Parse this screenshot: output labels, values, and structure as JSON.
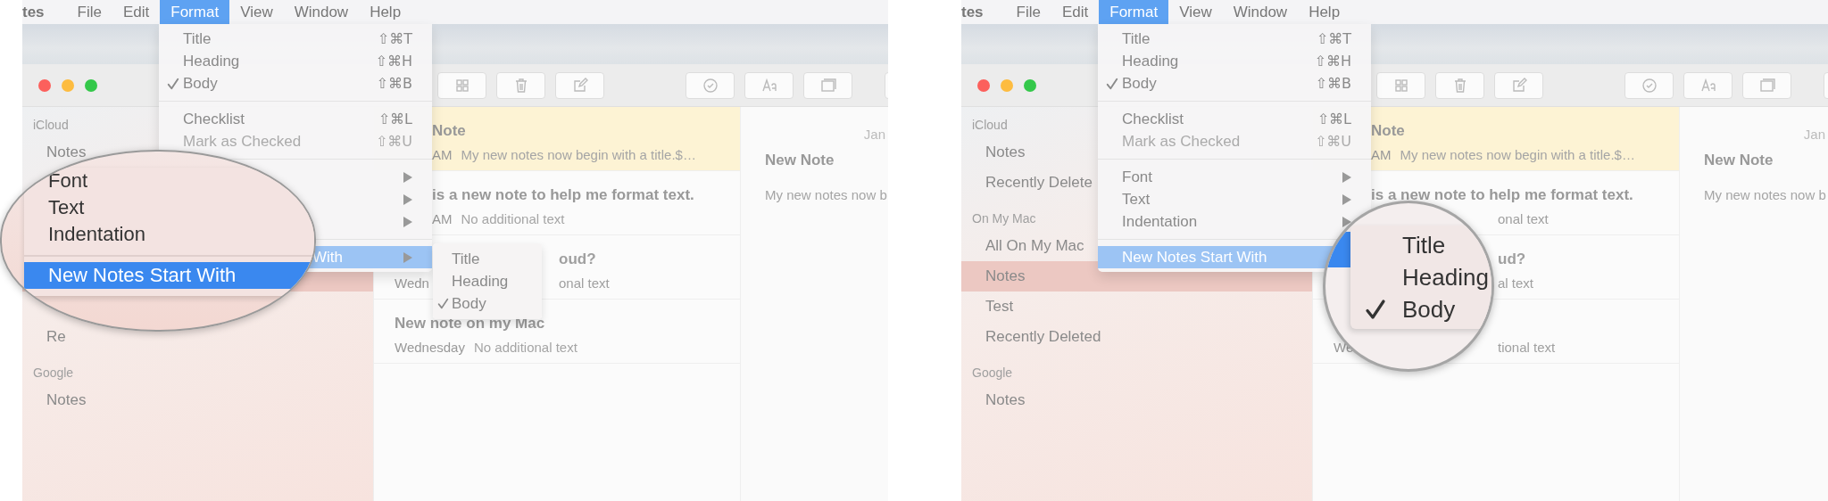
{
  "panels": [
    {
      "menubar": [
        {
          "label": "tes",
          "kind": "app",
          "selected": false
        },
        {
          "label": "File",
          "kind": "menu",
          "selected": false
        },
        {
          "label": "Edit",
          "kind": "menu",
          "selected": false
        },
        {
          "label": "Format",
          "kind": "menu",
          "selected": true
        },
        {
          "label": "View",
          "kind": "menu",
          "selected": false
        },
        {
          "label": "Window",
          "kind": "menu",
          "selected": false
        },
        {
          "label": "Help",
          "kind": "menu",
          "selected": false
        }
      ],
      "menu": [
        {
          "kind": "item",
          "label": "Title",
          "shortcut": "⇧⌘T",
          "checked": false,
          "disabled": false
        },
        {
          "kind": "item",
          "label": "Heading",
          "shortcut": "⇧⌘H",
          "checked": false,
          "disabled": false
        },
        {
          "kind": "item",
          "label": "Body",
          "shortcut": "⇧⌘B",
          "checked": true,
          "disabled": false
        },
        {
          "kind": "separator"
        },
        {
          "kind": "item",
          "label": "Checklist",
          "shortcut": "⇧⌘L",
          "checked": false,
          "disabled": false
        },
        {
          "kind": "item",
          "label": "Mark as Checked",
          "shortcut": "⇧⌘U",
          "checked": false,
          "disabled": true
        },
        {
          "kind": "separator"
        },
        {
          "kind": "submenu",
          "selected": false,
          "arrow": true
        },
        {
          "kind": "submenu",
          "selected": false,
          "arrow": true
        },
        {
          "kind": "submenu",
          "selected": false,
          "arrow": true
        },
        {
          "kind": "separator"
        },
        {
          "kind": "submenu",
          "label": "With",
          "selected": true,
          "cut": true,
          "arrow": true
        }
      ],
      "submenu": [
        {
          "label": "Title",
          "checked": false
        },
        {
          "label": "Heading",
          "checked": false
        },
        {
          "label": "Body",
          "checked": true
        }
      ],
      "sidebar": [
        {
          "title": "iCloud",
          "items": [
            {
              "kind": "row",
              "label": "Notes",
              "selected": false
            },
            {
              "kind": "hidden"
            }
          ]
        },
        {
          "items": [
            {
              "kind": "hidden"
            },
            {
              "kind": "row",
              "selected": true
            },
            {
              "kind": "hidden"
            },
            {
              "kind": "row",
              "label": "Re",
              "selected": false
            }
          ]
        },
        {
          "title": "Google",
          "items": [
            {
              "kind": "row",
              "label": "Notes",
              "selected": false
            }
          ]
        }
      ],
      "notes": [
        {
          "selected": true,
          "cut": true,
          "title": "Note",
          "time": "AM",
          "preview": "My new notes now begin with a title.$…"
        },
        {
          "selected": false,
          "cut": true,
          "title": "is a new note to help me format text.",
          "time": "AM",
          "preview": "No additional text"
        },
        {
          "selected": false,
          "cut": false,
          "title_tail": "oud?",
          "time": "Wedn",
          "preview_tail": "onal text"
        },
        {
          "selected": false,
          "cut": false,
          "title": "New note on my Mac",
          "time": "Wednesday",
          "preview": "No additional text"
        }
      ],
      "editor": {
        "date": "Jan",
        "title": "New Note",
        "body": "My new notes now b"
      },
      "lens": {
        "kind": "pill",
        "items": [
          {
            "kind": "item",
            "label": "Font"
          },
          {
            "kind": "item",
            "label": "Text"
          },
          {
            "kind": "item",
            "label": "Indentation"
          },
          {
            "kind": "separator"
          },
          {
            "kind": "item",
            "label": "New Notes Start With",
            "selected": true
          }
        ]
      }
    },
    {
      "menubar": [
        {
          "label": "tes",
          "kind": "app",
          "selected": false
        },
        {
          "label": "File",
          "kind": "menu",
          "selected": false
        },
        {
          "label": "Edit",
          "kind": "menu",
          "selected": false
        },
        {
          "label": "Format",
          "kind": "menu",
          "selected": true
        },
        {
          "label": "View",
          "kind": "menu",
          "selected": false
        },
        {
          "label": "Window",
          "kind": "menu",
          "selected": false
        },
        {
          "label": "Help",
          "kind": "menu",
          "selected": false
        }
      ],
      "menu": [
        {
          "kind": "item",
          "label": "Title",
          "shortcut": "⇧⌘T",
          "checked": false,
          "disabled": false
        },
        {
          "kind": "item",
          "label": "Heading",
          "shortcut": "⇧⌘H",
          "checked": false,
          "disabled": false
        },
        {
          "kind": "item",
          "label": "Body",
          "shortcut": "⇧⌘B",
          "checked": true,
          "disabled": false
        },
        {
          "kind": "separator"
        },
        {
          "kind": "item",
          "label": "Checklist",
          "shortcut": "⇧⌘L",
          "checked": false,
          "disabled": false
        },
        {
          "kind": "item",
          "label": "Mark as Checked",
          "shortcut": "⇧⌘U",
          "checked": false,
          "disabled": true
        },
        {
          "kind": "separator"
        },
        {
          "kind": "submenu",
          "label": "Font",
          "selected": false,
          "cut": false,
          "arrow": true
        },
        {
          "kind": "submenu",
          "label": "Text",
          "selected": false,
          "cut": false,
          "arrow": true
        },
        {
          "kind": "submenu",
          "label": "Indentation",
          "selected": false,
          "cut": false,
          "arrow": true
        },
        {
          "kind": "separator"
        },
        {
          "kind": "submenu",
          "label": "New Notes Start With",
          "selected": true,
          "cut": false
        }
      ],
      "sidebar": [
        {
          "title": "iCloud",
          "items": [
            {
              "label": "Notes",
              "selected": false
            },
            {
              "label": "Recently Delete",
              "selected": false
            }
          ]
        },
        {
          "title": "On My Mac",
          "items": [
            {
              "label": "All On My Mac",
              "selected": false
            },
            {
              "label": "Notes",
              "selected": true
            },
            {
              "label": "Test",
              "selected": false
            },
            {
              "label": "Recently Deleted",
              "selected": false
            }
          ]
        },
        {
          "title": "Google",
          "items": [
            {
              "label": "Notes",
              "selected": false
            }
          ]
        }
      ],
      "notes": [
        {
          "selected": true,
          "cut": true,
          "title": "Note",
          "time": "AM",
          "preview": "My new notes now begin with a title.$…"
        },
        {
          "selected": false,
          "cut": true,
          "title": "is a new note to help me format text.",
          "preview_tail": "onal text"
        },
        {
          "selected": false,
          "title_tail": "ud?",
          "preview_tail": "al text"
        },
        {
          "selected": false,
          "cut": false,
          "time": "We",
          "preview_tail": "tional text"
        }
      ],
      "editor": {
        "date": "Jan",
        "title": "New Note",
        "body": "My new notes now b"
      },
      "lens": {
        "kind": "circle",
        "items": [
          {
            "label": "Title",
            "checked": false
          },
          {
            "label": "Heading",
            "checked": false
          },
          {
            "label": "Body",
            "checked": true
          }
        ]
      }
    }
  ]
}
